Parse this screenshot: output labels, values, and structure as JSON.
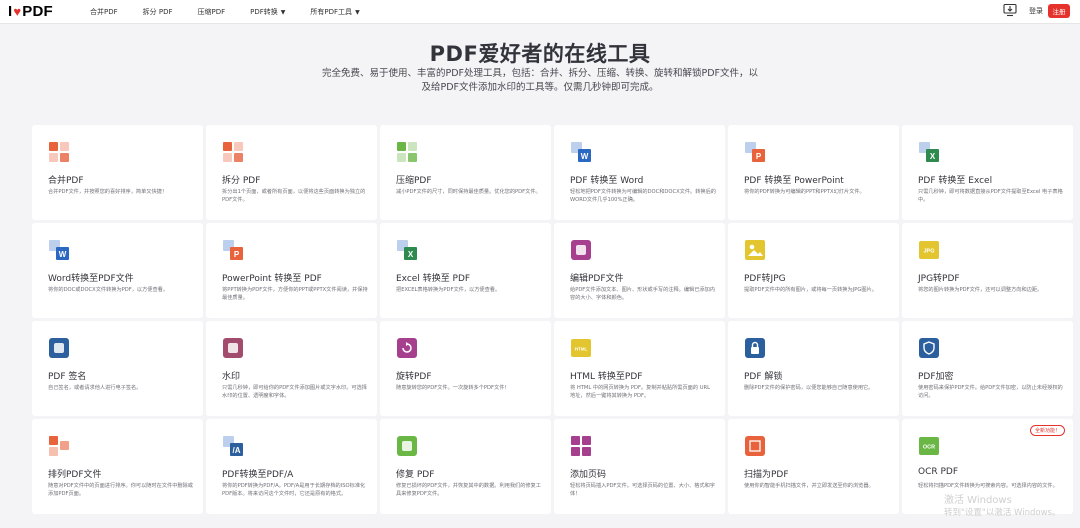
{
  "header": {
    "logo_prefix": "I",
    "logo_suffix": "PDF",
    "nav": [
      {
        "label": "合并PDF",
        "dropdown": false
      },
      {
        "label": "拆分 PDF",
        "dropdown": false
      },
      {
        "label": "压缩PDF",
        "dropdown": false
      },
      {
        "label": "PDF转换",
        "dropdown": true
      },
      {
        "label": "所有PDF工具",
        "dropdown": true
      }
    ],
    "login_label": "登录",
    "register_label": "注册"
  },
  "hero": {
    "title": "PDF爱好者的在线工具",
    "subtitle": "完全免费、易于使用、丰富的PDF处理工具，包括：合并、拆分、压缩、转换、旋转和解锁PDF文件，以及给PDF文件添加水印的工具等。仅需几秒钟即可完成。"
  },
  "tools": [
    {
      "name": "合并PDF",
      "desc": "合并PDF文件，并按照您的喜好排序，简单又快捷！",
      "icon": "merge-icon",
      "color": "#e8623c"
    },
    {
      "name": "拆分 PDF",
      "desc": "拆分出1个页面，或者所有页面，以便将这些页面转换为独立的PDF文件。",
      "icon": "split-icon",
      "color": "#e8623c"
    },
    {
      "name": "压缩PDF",
      "desc": "减小PDF文件的尺寸，同时保持最佳质量。优化您的PDF文件。",
      "icon": "compress-icon",
      "color": "#6bb745"
    },
    {
      "name": "PDF 转换至 Word",
      "desc": "轻松地把PDF文件转换为可编辑的DOC和DOCX文件。转换后的WORD文件几乎100%正确。",
      "icon": "pdf-to-word-icon",
      "color": "#2b68c1"
    },
    {
      "name": "PDF 转换至 PowerPoint",
      "desc": "将你的PDF转换为可编辑的PPT和PPTX幻灯片文件。",
      "icon": "pdf-to-powerpoint-icon",
      "color": "#e8623c"
    },
    {
      "name": "PDF 转换至 Excel",
      "desc": "只需几秒钟，即可将数据直接从PDF文件提取至Excel 电子表格中。",
      "icon": "pdf-to-excel-icon",
      "color": "#2e8a4e"
    },
    {
      "name": "Word转换至PDF文件",
      "desc": "将你的DOC或DOCX文件转换为PDF，以方便查看。",
      "icon": "word-to-pdf-icon",
      "color": "#2b68c1"
    },
    {
      "name": "PowerPoint 转换至 PDF",
      "desc": "将PPT转换为PDF文件，方便你的PPT或PPTX文件阅读，并保持最佳质量。",
      "icon": "powerpoint-to-pdf-icon",
      "color": "#e8623c"
    },
    {
      "name": "Excel 转换至 PDF",
      "desc": "把EXCEL表格转换为PDF文件，以方便查看。",
      "icon": "excel-to-pdf-icon",
      "color": "#2e8a4e"
    },
    {
      "name": "编辑PDF文件",
      "desc": "给PDF文件添加文本、图片、形状或手写的注释。编辑已添加内容的大小、字体和颜色。",
      "icon": "edit-pdf-icon",
      "color": "#a53f8e"
    },
    {
      "name": "PDF转JPG",
      "desc": "提取PDF文件中的所有图片，或将每一页转换为JPG图片。",
      "icon": "pdf-to-jpg-icon",
      "color": "#e3c62f"
    },
    {
      "name": "JPG转PDF",
      "desc": "将您的图片转换为PDF文件，还可以调整方向和边距。",
      "icon": "jpg-to-pdf-icon",
      "color": "#e3c62f"
    },
    {
      "name": "PDF 签名",
      "desc": "自己签名，或者请求他人进行电子签名。",
      "icon": "sign-pdf-icon",
      "color": "#2b5f9e"
    },
    {
      "name": "水印",
      "desc": "只需几秒钟，即可给你的PDF文件添加图片或文字水印。可选择水印的位置、透明度和字体。",
      "icon": "watermark-icon",
      "color": "#a34b6c"
    },
    {
      "name": "旋转PDF",
      "desc": "随意旋转您的PDF文件。一次旋转多个PDF文件！",
      "icon": "rotate-pdf-icon",
      "color": "#a53f8e"
    },
    {
      "name": "HTML 转换至PDF",
      "desc": "将 HTML 中的网页转换为 PDF。复制并粘贴所需页面的 URL 地址，然后一键将其转换为 PDF。",
      "icon": "html-to-pdf-icon",
      "color": "#e3c62f"
    },
    {
      "name": "PDF 解锁",
      "desc": "删除PDF文件的保护密码，以便您能够自己随意使用它。",
      "icon": "unlock-pdf-icon",
      "color": "#2b5f9e"
    },
    {
      "name": "PDF加密",
      "desc": "使用密码来保护PDF文件。给PDF文件加密，以防止未经授权的访问。",
      "icon": "protect-pdf-icon",
      "color": "#2b5f9e"
    },
    {
      "name": "排列PDF文件",
      "desc": "随意对PDF文件中的页面进行排序。你可以随时在文件中删除或添加PDF页面。",
      "icon": "organize-pdf-icon",
      "color": "#e8623c"
    },
    {
      "name": "PDF转换至PDF/A",
      "desc": "将你的PDF转换为PDF/A。PDF/A是用于长期存档的ISO标准化PDF版本。将来访问这个文件时，它还是原有的格式。",
      "icon": "pdf-to-pdfa-icon",
      "color": "#2b5f9e"
    },
    {
      "name": "修复 PDF",
      "desc": "修复已损坏的PDF文件，并恢复其中的数据。利用我们的修复工具来修复PDF文件。",
      "icon": "repair-pdf-icon",
      "color": "#6bb745"
    },
    {
      "name": "添加页码",
      "desc": "轻松将页码插入PDF文件。可选择页码的位置、大小、格式和字体！",
      "icon": "page-numbers-icon",
      "color": "#a53f8e"
    },
    {
      "name": "扫描为PDF",
      "desc": "使用你的智能手机扫描文件，并立即发送至你的浏览器。",
      "icon": "scan-to-pdf-icon",
      "color": "#e8623c"
    },
    {
      "name": "OCR PDF",
      "desc": "轻松将扫描PDF文件转换为可搜索内容。可选择内容的文件。",
      "icon": "ocr-pdf-icon",
      "color": "#6bb745",
      "badge": "全新功能！"
    }
  ],
  "watermark": {
    "line1": "激活 Windows",
    "line2": "转到\"设置\"以激活 Windows。"
  }
}
